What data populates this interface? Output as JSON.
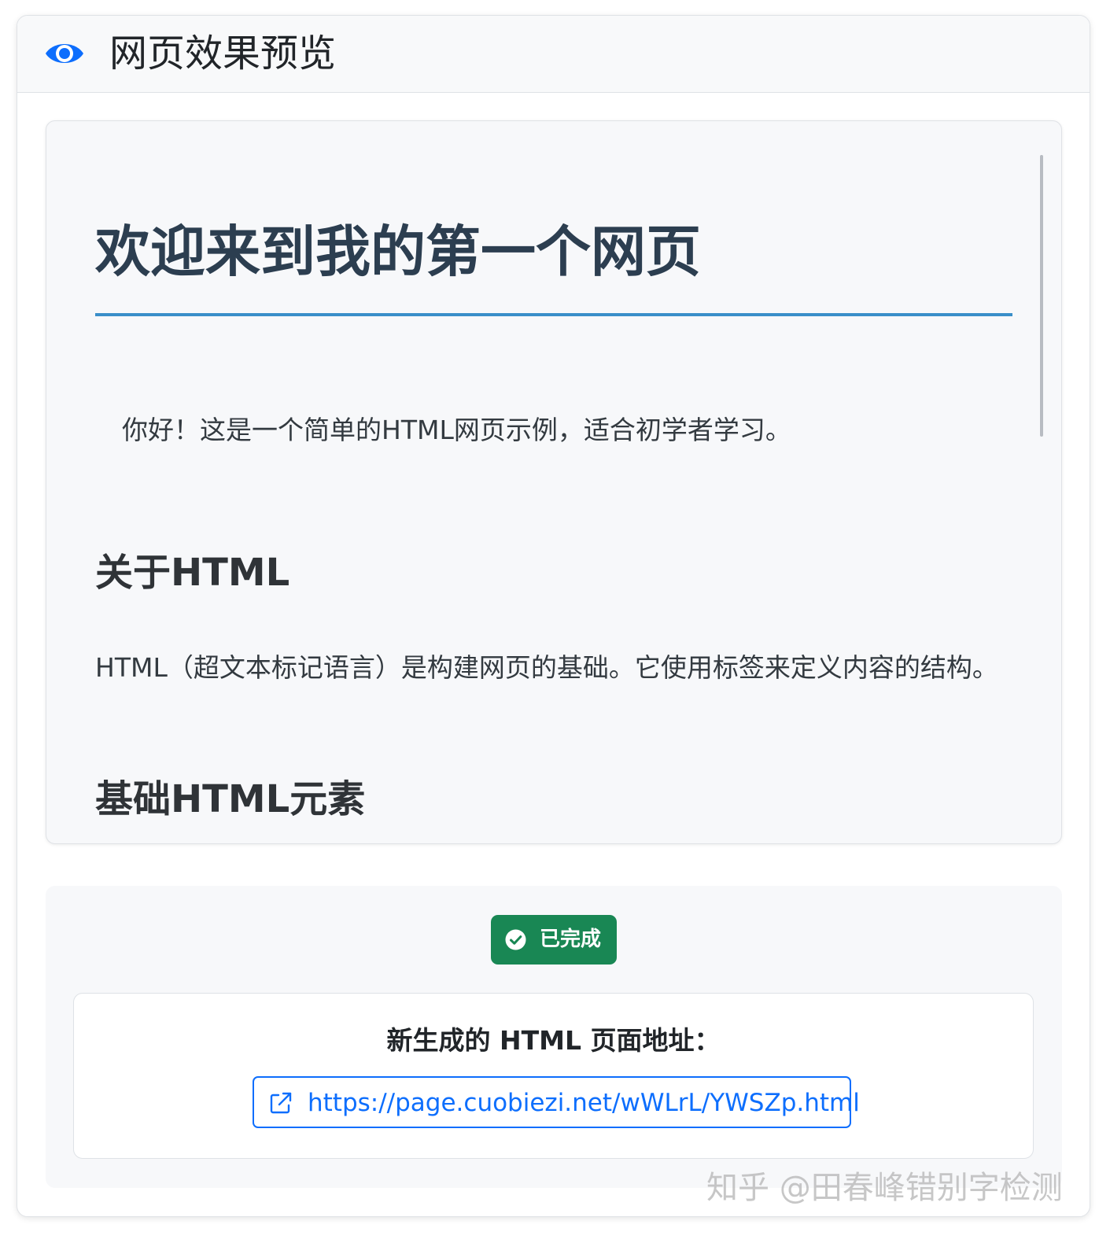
{
  "header": {
    "icon": "eye-icon",
    "title": "网页效果预览"
  },
  "preview": {
    "h1": "欢迎来到我的第一个网页",
    "intro": "你好！这是一个简单的HTML网页示例，适合初学者学习。",
    "section_about_title": "关于HTML",
    "section_about_text": "HTML（超文本标记语言）是构建网页的基础。它使用标签来定义内容的结构。",
    "section_basic_title": "基础HTML元素"
  },
  "status": {
    "badge_label": "已完成",
    "badge_icon": "check-circle-icon",
    "badge_color": "#198754",
    "url_label": "新生成的 HTML 页面地址：",
    "url_icon": "external-link-icon",
    "url": "https://page.cuobiezi.net/wWLrL/YWSZp.html",
    "link_color": "#0d6efd"
  },
  "watermark": "知乎 @田春峰错别字检测"
}
